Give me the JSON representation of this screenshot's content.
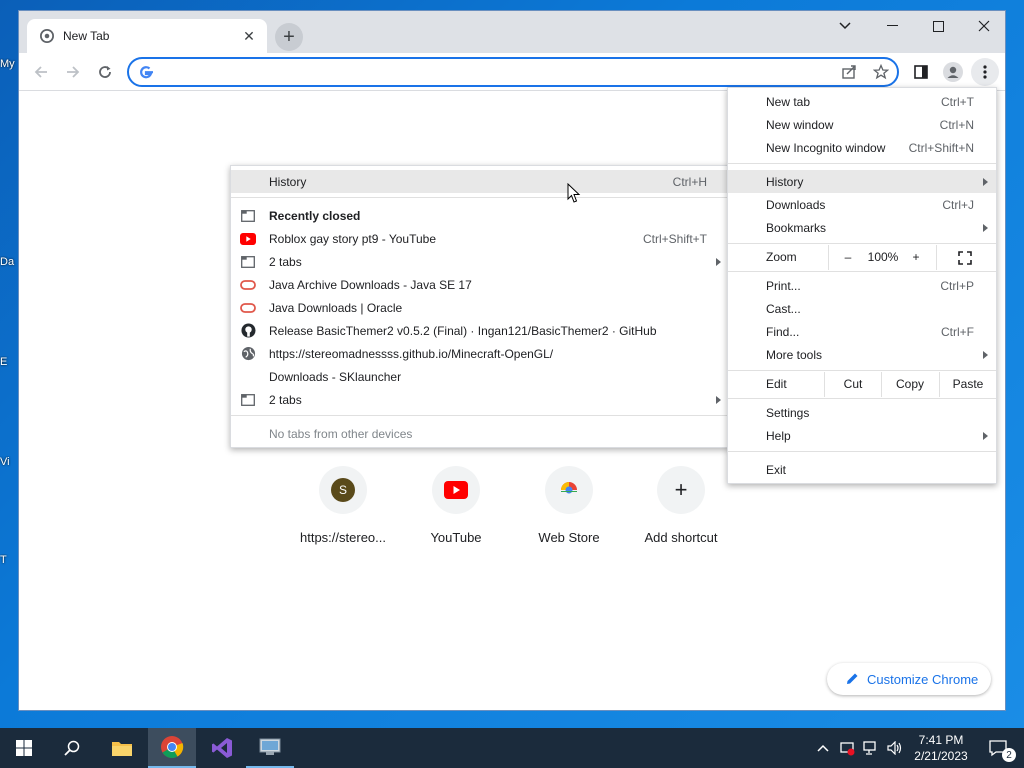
{
  "desktop": {
    "icons": [
      "My",
      "Da",
      "E",
      "Vi",
      "T"
    ]
  },
  "browser": {
    "tab_title": "New Tab",
    "omnibox": {
      "value": "",
      "placeholder": ""
    },
    "accent_color": "#1a73e8"
  },
  "new_tab_page": {
    "shortcuts": [
      {
        "label": "https://stereo...",
        "icon": "letter-s-icon",
        "letter": "S"
      },
      {
        "label": "YouTube",
        "icon": "youtube-icon"
      },
      {
        "label": "Web Store",
        "icon": "web-store-icon"
      },
      {
        "label": "Add shortcut",
        "icon": "plus-icon"
      }
    ],
    "customize_label": "Customize Chrome"
  },
  "main_menu": {
    "new_tab": {
      "label": "New tab",
      "shortcut": "Ctrl+T"
    },
    "new_window": {
      "label": "New window",
      "shortcut": "Ctrl+N"
    },
    "new_incognito": {
      "label": "New Incognito window",
      "shortcut": "Ctrl+Shift+N"
    },
    "history": {
      "label": "History"
    },
    "downloads": {
      "label": "Downloads",
      "shortcut": "Ctrl+J"
    },
    "bookmarks": {
      "label": "Bookmarks"
    },
    "zoom": {
      "label": "Zoom",
      "minus": "–",
      "value": "100%",
      "plus": "+"
    },
    "print": {
      "label": "Print...",
      "shortcut": "Ctrl+P"
    },
    "cast": {
      "label": "Cast..."
    },
    "find": {
      "label": "Find...",
      "shortcut": "Ctrl+F"
    },
    "more_tools": {
      "label": "More tools"
    },
    "edit": {
      "label": "Edit",
      "cut": "Cut",
      "copy": "Copy",
      "paste": "Paste"
    },
    "settings": {
      "label": "Settings"
    },
    "help": {
      "label": "Help"
    },
    "exit": {
      "label": "Exit"
    }
  },
  "history_menu": {
    "history": {
      "label": "History",
      "shortcut": "Ctrl+H"
    },
    "recently_closed": "Recently closed",
    "items": [
      {
        "label": "Roblox gay story pt9 - YouTube",
        "shortcut": "Ctrl+Shift+T",
        "icon": "youtube-icon",
        "submenu": false
      },
      {
        "label": "2 tabs",
        "shortcut": "",
        "icon": "tabs-icon",
        "submenu": true
      },
      {
        "label": "Java Archive Downloads - Java SE 17",
        "shortcut": "",
        "icon": "oracle-icon",
        "submenu": false
      },
      {
        "label": "Java Downloads | Oracle",
        "shortcut": "",
        "icon": "oracle-icon",
        "submenu": false
      },
      {
        "label": "Release BasicThemer2 v0.5.2 (Final) · Ingan121/BasicThemer2 · GitHub",
        "shortcut": "",
        "icon": "github-icon",
        "submenu": false
      },
      {
        "label": "https://stereomadnessss.github.io/Minecraft-OpenGL/",
        "shortcut": "",
        "icon": "globe-icon",
        "submenu": false
      },
      {
        "label": "Downloads - SKlauncher",
        "shortcut": "",
        "icon": "",
        "submenu": false
      },
      {
        "label": "2 tabs",
        "shortcut": "",
        "icon": "tabs-icon",
        "submenu": true
      }
    ],
    "no_tabs": "No tabs from other devices"
  },
  "taskbar": {
    "time": "7:41 PM",
    "date": "2/21/2023",
    "notification_count": "2"
  }
}
